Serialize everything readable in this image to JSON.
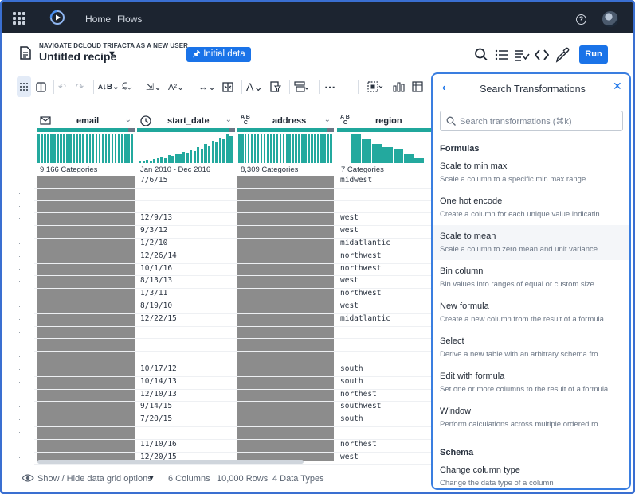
{
  "nav": {
    "home": "Home",
    "flows": "Flows",
    "help_glyph": "?"
  },
  "header": {
    "subtitle": "NAVIGATE DCLOUD TRIFACTA AS A NEW USER",
    "title": "Untitled recipe",
    "initial_data": "Initial data",
    "run": "Run"
  },
  "columns": [
    {
      "name": "email",
      "type_icon": "envelope-icon",
      "categories": "9,166 Categories"
    },
    {
      "name": "start_date",
      "type_icon": "clock-icon",
      "categories": "Jan 2010 - Dec 2016"
    },
    {
      "name": "address",
      "type_icon": "abc-icon",
      "categories": "8,309 Categories"
    },
    {
      "name": "region",
      "type_icon": "abc-icon",
      "categories": "7 Categories"
    }
  ],
  "rows": [
    {
      "start_date": "7/6/15",
      "region": "midwest"
    },
    {
      "start_date": "",
      "region": ""
    },
    {
      "start_date": "",
      "region": ""
    },
    {
      "start_date": "12/9/13",
      "region": "west"
    },
    {
      "start_date": "9/3/12",
      "region": "west"
    },
    {
      "start_date": "1/2/10",
      "region": "midatlantic"
    },
    {
      "start_date": "12/26/14",
      "region": "northwest"
    },
    {
      "start_date": "10/1/16",
      "region": "northwest"
    },
    {
      "start_date": "8/13/13",
      "region": "west"
    },
    {
      "start_date": "1/3/11",
      "region": "northwest"
    },
    {
      "start_date": "8/19/10",
      "region": "west"
    },
    {
      "start_date": "12/22/15",
      "region": "midatlantic"
    },
    {
      "start_date": "",
      "region": ""
    },
    {
      "start_date": "",
      "region": ""
    },
    {
      "start_date": "",
      "region": ""
    },
    {
      "start_date": "10/17/12",
      "region": "south"
    },
    {
      "start_date": "10/14/13",
      "region": "south"
    },
    {
      "start_date": "12/10/13",
      "region": "northest"
    },
    {
      "start_date": "9/14/15",
      "region": "southwest"
    },
    {
      "start_date": "7/20/15",
      "region": "south"
    },
    {
      "start_date": "",
      "region": ""
    },
    {
      "start_date": "11/10/16",
      "region": "northest"
    },
    {
      "start_date": "12/20/15",
      "region": "west"
    }
  ],
  "footer": {
    "toggle": "Show / Hide data grid options",
    "columns": "6 Columns",
    "rows": "10,000 Rows",
    "types": "4 Data Types"
  },
  "panel": {
    "title": "Search Transformations",
    "search_placeholder": "Search transformations (⌘k)",
    "formulas_heading": "Formulas",
    "schema_heading": "Schema",
    "transforms": [
      {
        "name": "Scale to min max",
        "desc": "Scale a column to a specific min max range"
      },
      {
        "name": "One hot encode",
        "desc": "Create a column for each unique value indicatin..."
      },
      {
        "name": "Scale to mean",
        "desc": "Scale a column to zero mean and unit variance"
      },
      {
        "name": "Bin column",
        "desc": "Bin values into ranges of equal or custom size"
      },
      {
        "name": "New formula",
        "desc": "Create a new column from the result of a formula"
      },
      {
        "name": "Select",
        "desc": "Derive a new table with an arbitrary schema fro..."
      },
      {
        "name": "Edit with formula",
        "desc": "Set one or more columns to the result of a formula"
      },
      {
        "name": "Window",
        "desc": "Perform calculations across multiple ordered ro..."
      }
    ],
    "schema_transforms": [
      {
        "name": "Change column type",
        "desc": "Change the data type of a column"
      }
    ]
  },
  "colors": {
    "accent": "#1a73e8",
    "teal": "#20a79c",
    "nav_bg": "#1c2430"
  }
}
